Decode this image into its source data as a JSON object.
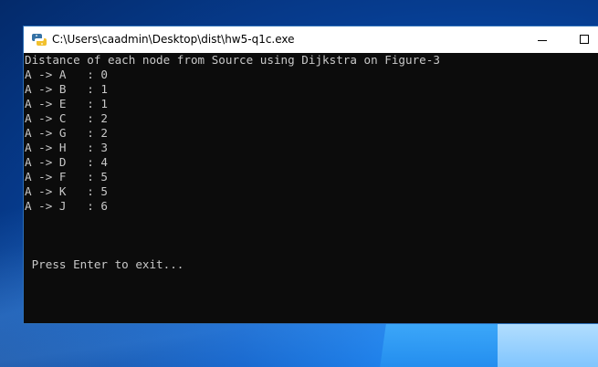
{
  "window": {
    "title": "C:\\Users\\caadmin\\Desktop\\dist\\hw5-q1c.exe",
    "icon": "python-icon"
  },
  "console": {
    "header": "Distance of each node from Source using Dijkstra on Figure-3",
    "results": [
      "A -> A   : 0",
      "A -> B   : 1",
      "A -> E   : 1",
      "A -> C   : 2",
      "A -> G   : 2",
      "A -> H   : 3",
      "A -> D   : 4",
      "A -> F   : 5",
      "A -> K   : 5",
      "A -> J   : 6"
    ],
    "prompt": " Press Enter to exit..."
  },
  "colors": {
    "console_bg": "#0c0c0c",
    "console_fg": "#c8c8c8",
    "titlebar_bg": "#ffffff",
    "desktop_accent": "#1e90ff"
  }
}
